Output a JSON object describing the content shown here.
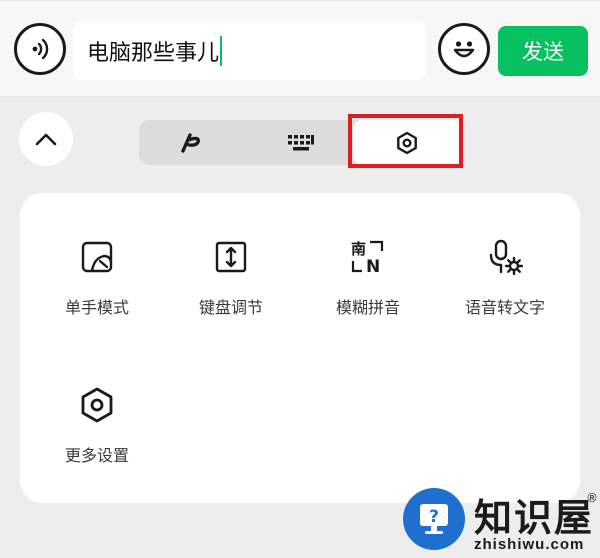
{
  "input_bar": {
    "text": "电脑那些事儿",
    "send_label": "发送",
    "voice_icon": "voice-icon",
    "emoji_icon": "emoji-icon"
  },
  "keyboard_modes": {
    "icons": [
      "chevron-up-icon",
      "handwrite-icon",
      "keyboard-icon",
      "settings-hex-icon"
    ],
    "selected": "settings"
  },
  "tools": [
    {
      "label": "单手模式",
      "icon": "one-hand-mode-icon"
    },
    {
      "label": "键盘调节",
      "icon": "keyboard-resize-icon"
    },
    {
      "label": "模糊拼音",
      "icon": "fuzzy-pinyin-icon"
    },
    {
      "label": "语音转文字",
      "icon": "voice-to-text-icon"
    },
    {
      "label": "更多设置",
      "icon": "more-settings-icon"
    }
  ],
  "watermark": {
    "name": "知识屋",
    "domain": "zhishiwu.com",
    "reg_mark": "®"
  },
  "colors": {
    "accent_green": "#07c160",
    "highlight_red": "#dd1f24",
    "brand_blue": "#1e6fd0"
  }
}
